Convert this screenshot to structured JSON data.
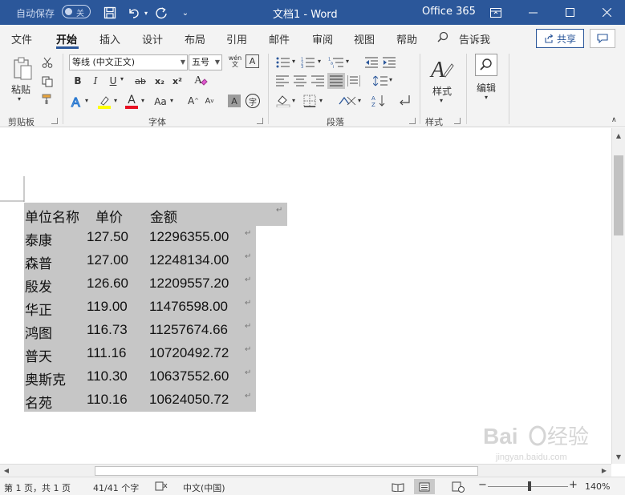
{
  "titlebar": {
    "autosave_label": "自动保存",
    "autosave_state": "关",
    "doc_title": "文档1  -  Word",
    "office_label": "Office 365"
  },
  "ribbon_tabs": [
    "文件",
    "开始",
    "插入",
    "设计",
    "布局",
    "引用",
    "邮件",
    "审阅",
    "视图",
    "帮助"
  ],
  "tell_me": "告诉我",
  "share_label": "共享",
  "clipboard": {
    "paste_label": "粘贴",
    "group_label": "剪贴板"
  },
  "font": {
    "font_name": "等线 (中文正文)",
    "font_size": "五号",
    "group_label": "字体",
    "phonetic_label": "wén",
    "bold": "B",
    "italic": "I",
    "underline": "U",
    "strike": "ab",
    "subscript": "x₂",
    "superscript": "x²",
    "font_color_letter": "A",
    "change_case": "Aa",
    "grow": "A",
    "shrink": "A",
    "char_shading": "A",
    "enclose": "字",
    "highlight_color": "#ffff00",
    "font_color": "#e81123"
  },
  "paragraph": {
    "group_label": "段落"
  },
  "styles": {
    "label": "样式",
    "group_label": "样式"
  },
  "editing": {
    "label": "编辑"
  },
  "table": {
    "headers": [
      "单位名称",
      "单价",
      "金额"
    ],
    "rows": [
      [
        "泰康",
        "127.50",
        "12296355.00"
      ],
      [
        "森普",
        "127.00",
        "12248134.00"
      ],
      [
        "殷发",
        "126.60",
        "12209557.20"
      ],
      [
        "华正",
        "119.00",
        "11476598.00"
      ],
      [
        "鸿图",
        "116.73",
        "11257674.66"
      ],
      [
        "普天",
        "111.16",
        "10720492.72"
      ],
      [
        "奥斯克",
        "110.30",
        "10637552.60"
      ],
      [
        "名苑",
        "110.16",
        "10624050.72"
      ]
    ],
    "paragraph_mark": "↵"
  },
  "status": {
    "page": "第 1 页，共 1 页",
    "words": "41/41 个字",
    "language": "中文(中国)",
    "zoom": "140%",
    "minus": "−",
    "plus": "+"
  }
}
